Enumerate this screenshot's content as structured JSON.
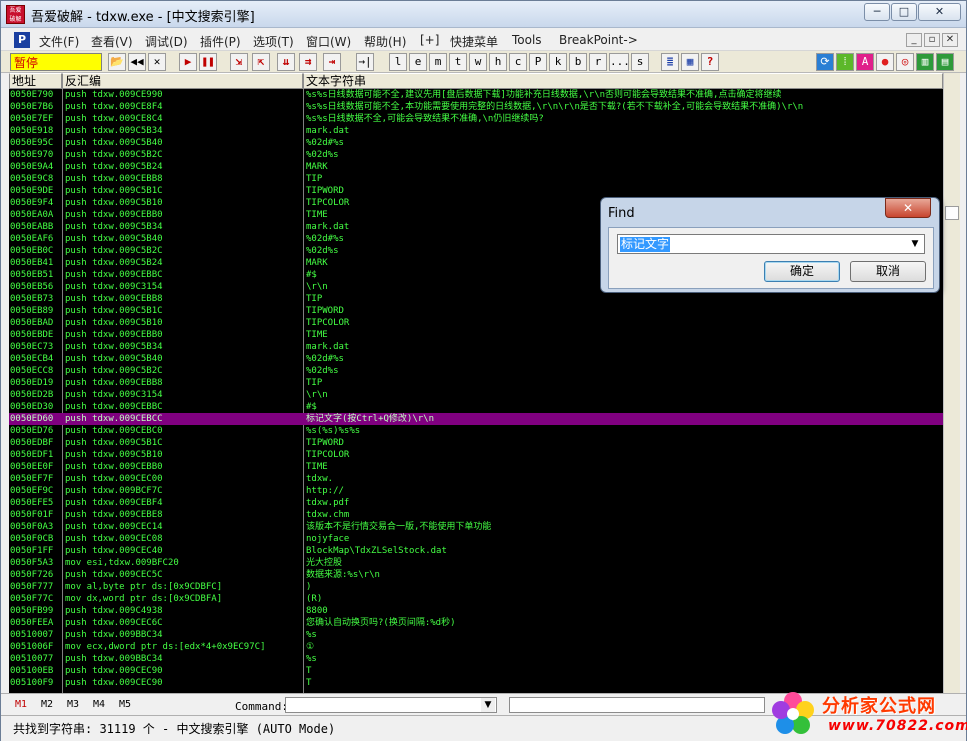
{
  "window": {
    "app_icon_text": "吾爱破解",
    "title": "吾爱破解 - tdxw.exe - [中文搜索引擎]",
    "minimize": "─",
    "maximize": "□",
    "close": "✕"
  },
  "menubar": {
    "app_icon": "P",
    "items": [
      "文件(F)",
      "查看(V)",
      "调试(D)",
      "插件(P)",
      "选项(T)",
      "窗口(W)",
      "帮助(H)",
      "[+]",
      "快捷菜单",
      "Tools",
      "BreakPoint->"
    ],
    "mdi_controls": [
      "_",
      "▫",
      "✕"
    ]
  },
  "toolbar": {
    "state": "暂停",
    "icon_names": [
      "open-icon",
      "rewind-icon",
      "close-icon",
      "run-icon",
      "pause-icon",
      "step-into-icon",
      "step-over-icon",
      "trace-into-icon",
      "trace-over-icon",
      "execute-till-return-icon",
      "goto-icon"
    ],
    "buttons_glyphs": [
      "📂",
      "◀◀",
      "✕",
      "▶",
      "❚❚",
      "⇲",
      "⇱",
      "⇊",
      "⇉",
      "⇥",
      "→|"
    ],
    "letters": [
      "l",
      "e",
      "m",
      "t",
      "w",
      "h",
      "c",
      "P",
      "k",
      "b",
      "r",
      "...",
      "s"
    ],
    "right_icons": [
      "list-icon",
      "grid-icon",
      "help-icon",
      "refresh-icon",
      "plugin-icon",
      "a-icon",
      "ball-icon",
      "target-icon",
      "chart-icon",
      "frame-icon"
    ],
    "right_glyphs": [
      "≣",
      "▦",
      "?",
      "⟳",
      "⁞",
      "A",
      "●",
      "◎",
      "▥",
      "▤"
    ],
    "accent": "#ffff00",
    "state_color": "#d00000"
  },
  "columns": {
    "address": "地址",
    "disasm": "反汇编",
    "text": "文本字符串"
  },
  "rows": [
    {
      "addr": "0050E790",
      "asm": "push tdxw.009CE990",
      "text": "%s%s日线数据可能不全,建议先用[盘后数据下载]功能补充日线数据,\\r\\n否则可能会导致结果不准确,点击确定将继续"
    },
    {
      "addr": "0050E7B6",
      "asm": "push tdxw.009CE8F4",
      "text": "%s%s日线数据可能不全,本功能需要使用完整的日线数据,\\r\\n\\r\\n是否下载?(若不下载补全,可能会导致结果不准确)\\r\\n"
    },
    {
      "addr": "0050E7EF",
      "asm": "push tdxw.009CE8C4",
      "text": "%s%s日线数据不全,可能会导致结果不准确,\\n仍旧继续吗?"
    },
    {
      "addr": "0050E918",
      "asm": "push tdxw.009C5B34",
      "text": "mark.dat"
    },
    {
      "addr": "0050E95C",
      "asm": "push tdxw.009C5B40",
      "text": "%02d#%s"
    },
    {
      "addr": "0050E970",
      "asm": "push tdxw.009C5B2C",
      "text": "%02d%s"
    },
    {
      "addr": "0050E9A4",
      "asm": "push tdxw.009C5B24",
      "text": "MARK"
    },
    {
      "addr": "0050E9C8",
      "asm": "push tdxw.009CEBB8",
      "text": "TIP"
    },
    {
      "addr": "0050E9DE",
      "asm": "push tdxw.009C5B1C",
      "text": "TIPWORD"
    },
    {
      "addr": "0050E9F4",
      "asm": "push tdxw.009C5B10",
      "text": "TIPCOLOR"
    },
    {
      "addr": "0050EA0A",
      "asm": "push tdxw.009CEBB0",
      "text": "TIME"
    },
    {
      "addr": "0050EABB",
      "asm": "push tdxw.009C5B34",
      "text": "mark.dat"
    },
    {
      "addr": "0050EAF6",
      "asm": "push tdxw.009C5B40",
      "text": "%02d#%s"
    },
    {
      "addr": "0050EB0C",
      "asm": "push tdxw.009C5B2C",
      "text": "%02d%s"
    },
    {
      "addr": "0050EB41",
      "asm": "push tdxw.009C5B24",
      "text": "MARK"
    },
    {
      "addr": "0050EB51",
      "asm": "push tdxw.009CEBBC",
      "text": "#$"
    },
    {
      "addr": "0050EB56",
      "asm": "push tdxw.009C3154",
      "text": "\\r\\n"
    },
    {
      "addr": "0050EB73",
      "asm": "push tdxw.009CEBB8",
      "text": "TIP"
    },
    {
      "addr": "0050EB89",
      "asm": "push tdxw.009C5B1C",
      "text": "TIPWORD"
    },
    {
      "addr": "0050EBAD",
      "asm": "push tdxw.009C5B10",
      "text": "TIPCOLOR"
    },
    {
      "addr": "0050EBDE",
      "asm": "push tdxw.009CEBB0",
      "text": "TIME"
    },
    {
      "addr": "0050EC73",
      "asm": "push tdxw.009C5B34",
      "text": "mark.dat"
    },
    {
      "addr": "0050ECB4",
      "asm": "push tdxw.009C5B40",
      "text": "%02d#%s"
    },
    {
      "addr": "0050ECC8",
      "asm": "push tdxw.009C5B2C",
      "text": "%02d%s"
    },
    {
      "addr": "0050ED19",
      "asm": "push tdxw.009CEBB8",
      "text": "TIP"
    },
    {
      "addr": "0050ED2B",
      "asm": "push tdxw.009C3154",
      "text": "\\r\\n"
    },
    {
      "addr": "0050ED30",
      "asm": "push tdxw.009CEBBC",
      "text": "#$"
    },
    {
      "addr": "0050ED60",
      "asm": "push tdxw.009CEBCC",
      "text": "标记文字(按Ctrl+Q修改)\\r\\n",
      "selected": true
    },
    {
      "addr": "0050ED76",
      "asm": "push tdxw.009CEBC0",
      "text": "%s(%s)%s%s"
    },
    {
      "addr": "0050EDBF",
      "asm": "push tdxw.009C5B1C",
      "text": "TIPWORD"
    },
    {
      "addr": "0050EDF1",
      "asm": "push tdxw.009C5B10",
      "text": "TIPCOLOR"
    },
    {
      "addr": "0050EE0F",
      "asm": "push tdxw.009CEBB0",
      "text": "TIME"
    },
    {
      "addr": "0050EF7F",
      "asm": "push tdxw.009CEC00",
      "text": "tdxw."
    },
    {
      "addr": "0050EF9C",
      "asm": "push tdxw.009BCF7C",
      "text": "http://"
    },
    {
      "addr": "0050EFE5",
      "asm": "push tdxw.009CEBF4",
      "text": "tdxw.pdf"
    },
    {
      "addr": "0050F01F",
      "asm": "push tdxw.009CEBE8",
      "text": "tdxw.chm"
    },
    {
      "addr": "0050F0A3",
      "asm": "push tdxw.009CEC14",
      "text": "该版本不是行情交易合一版,不能使用下单功能"
    },
    {
      "addr": "0050F0CB",
      "asm": "push tdxw.009CEC08",
      "text": "nojyface"
    },
    {
      "addr": "0050F1FF",
      "asm": "push tdxw.009CEC40",
      "text": "BlockMap\\TdxZLSelStock.dat"
    },
    {
      "addr": "0050F5A3",
      "asm": "mov esi,tdxw.009BFC20",
      "text": "光大控股"
    },
    {
      "addr": "0050F726",
      "asm": "push tdxw.009CEC5C",
      "text": "数据来源:%s\\r\\n"
    },
    {
      "addr": "0050F777",
      "asm": "mov al,byte ptr ds:[0x9CDBFC]",
      "text": ")"
    },
    {
      "addr": "0050F77C",
      "asm": "mov dx,word ptr ds:[0x9CDBFA]",
      "text": "(R)"
    },
    {
      "addr": "0050FB99",
      "asm": "push tdxw.009C4938",
      "text": "8800"
    },
    {
      "addr": "0050FEEA",
      "asm": "push tdxw.009CEC6C",
      "text": "您确认自动换页吗?(换页间隔:%d秒)"
    },
    {
      "addr": "00510007",
      "asm": "push tdxw.009BBC34",
      "text": "%s"
    },
    {
      "addr": "0051006F",
      "asm": "mov ecx,dword ptr ds:[edx*4+0x9EC97C]",
      "text": "①"
    },
    {
      "addr": "00510077",
      "asm": "push tdxw.009BBC34",
      "text": "%s"
    },
    {
      "addr": "005100EB",
      "asm": "push tdxw.009CEC90",
      "text": "T"
    },
    {
      "addr": "005100F9",
      "asm": "push tdxw.009CEC90",
      "text": "T"
    }
  ],
  "cmdbar": {
    "tabs": [
      "M1",
      "M2",
      "M3",
      "M4",
      "M5"
    ],
    "label": "Command:",
    "value": ""
  },
  "status": {
    "text": "共找到字符串: 31119 个  -  中文搜索引擎 (AUTO Mode)"
  },
  "watermark": {
    "line1": "分析家公式网",
    "line2": "www.70822.com"
  },
  "find_dialog": {
    "title": "Find",
    "close": "✕",
    "value": "标记文字",
    "ok_label": "确定",
    "cancel_label": "取消"
  }
}
